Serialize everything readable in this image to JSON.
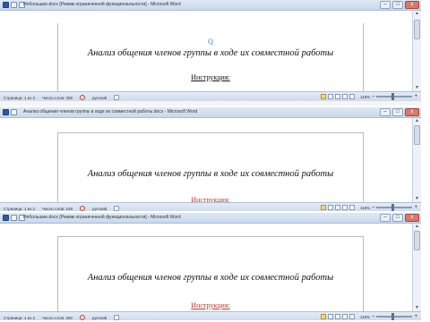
{
  "windows": [
    {
      "title": "Небольшие.docx [Режим ограниченной функциональности] - Microsoft Word",
      "doc_title": "Анализ общения членов группы в ходе их совместной работы",
      "instruction": "Инструкция:",
      "cursor_glyph": "Q",
      "status": {
        "page": "Страница: 1 из 2",
        "words": "Число слов: 258",
        "lang": "русский",
        "zoom": "118%"
      }
    },
    {
      "title": "Анализ общения членов группы в ходе их совместной работы.docx - Microsoft Word",
      "doc_title": "Анализ общения членов группы в ходе их совместной работы",
      "instruction": "Инструкция:",
      "status": {
        "page": "Страница: 1 из 2",
        "words": "Число слов: 249",
        "lang": "русский",
        "zoom": "118%"
      }
    },
    {
      "title": "Небольшие.docx [Режим ограниченной функциональности] - Microsoft Word",
      "doc_title": "Анализ общения членов группы в ходе их совместной работы",
      "instruction": "Инструкция:",
      "status": {
        "page": "Страница: 1 из 2",
        "words": "Число слов: 250",
        "lang": "русский",
        "zoom": "118%"
      }
    }
  ],
  "controls": {
    "minimize": "–",
    "maximize": "□",
    "close": "x",
    "scroll_up": "▲",
    "scroll_down": "▼",
    "zoom_minus": "–",
    "zoom_plus": "+"
  },
  "colors": {
    "instruction_red": "#c0392b",
    "titlebar": "#c8d8ec",
    "statusbar": "#cfdcee"
  }
}
